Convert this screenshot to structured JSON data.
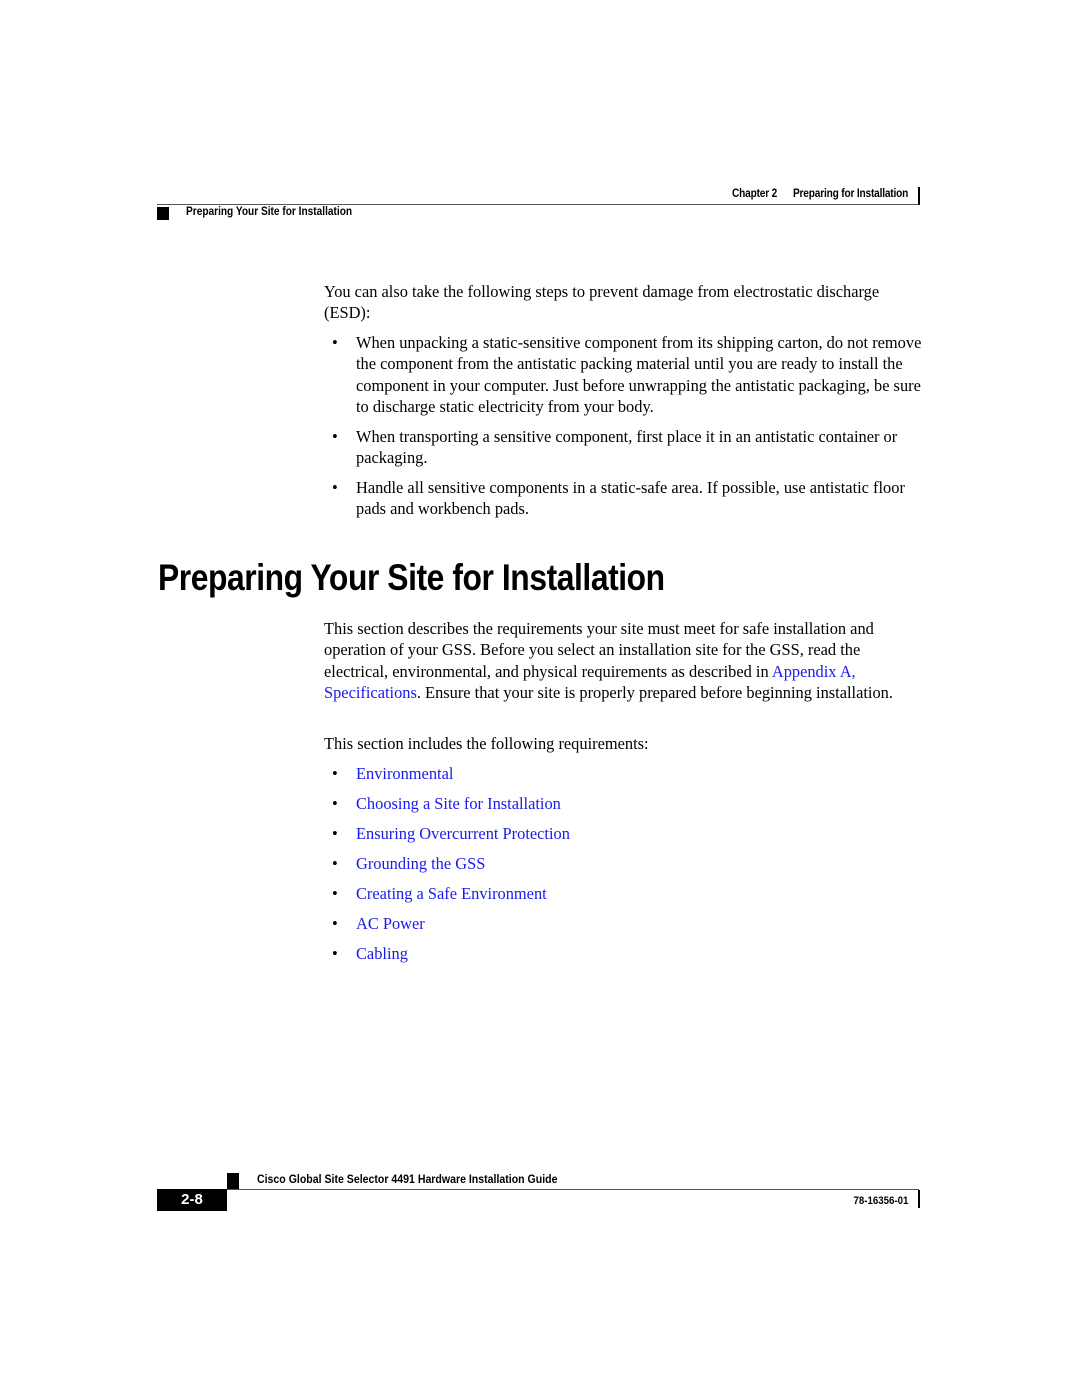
{
  "header": {
    "chapter": "Chapter 2",
    "chapter_title": "Preparing for Installation",
    "section": "Preparing Your Site for Installation"
  },
  "intro": {
    "text": "You can also take the following steps to prevent damage from electrostatic discharge (ESD):",
    "bullets": [
      "When unpacking a static-sensitive component from its shipping carton, do not remove the component from the antistatic packing material until you are ready to install the component in your computer. Just before unwrapping the antistatic packaging, be sure to discharge static electricity from your body.",
      "When transporting a sensitive component, first place it in an antistatic container or packaging.",
      "Handle all sensitive components in a static-safe area. If possible, use antistatic floor pads and workbench pads."
    ]
  },
  "section": {
    "heading": "Preparing Your Site for Installation",
    "para_before_link": "This section describes the requirements your site must meet for safe installation and operation of your GSS. Before you select an installation site for the GSS, read the electrical, environmental, and physical requirements as described in ",
    "link": "Appendix A, Specifications",
    "para_after_link": ". Ensure that your site is properly prepared before beginning installation.",
    "list_intro": "This section includes the following requirements:",
    "links": [
      "Environmental",
      "Choosing a Site for Installation",
      "Ensuring Overcurrent Protection",
      "Grounding the GSS",
      "Creating a Safe Environment",
      "AC Power",
      "Cabling"
    ]
  },
  "footer": {
    "guide_title": "Cisco Global Site Selector 4491 Hardware Installation Guide",
    "page_number": "2-8",
    "doc_number": "78-16356-01"
  },
  "colors": {
    "link": "#1a1aee",
    "text": "#000000"
  }
}
